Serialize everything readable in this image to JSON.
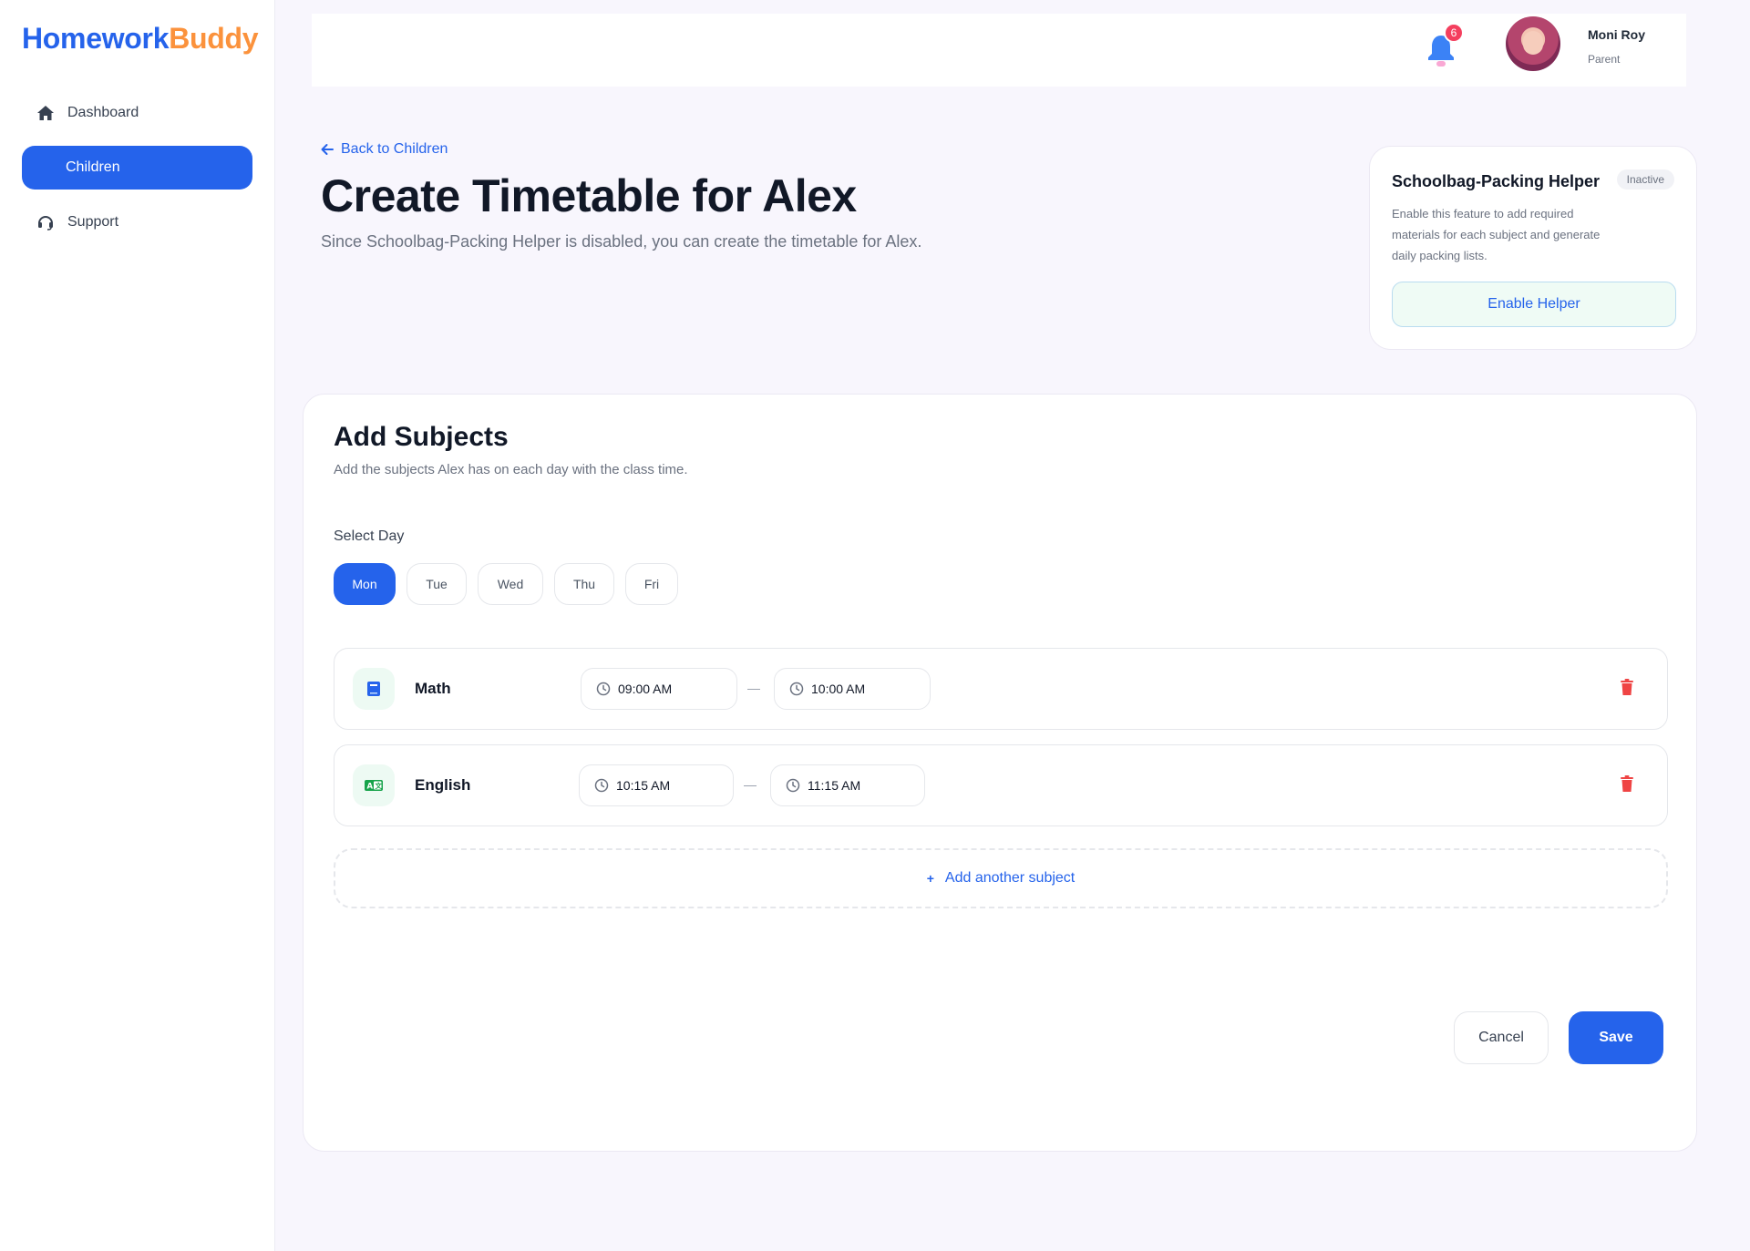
{
  "app": {
    "logo_part1": "Homework",
    "logo_part2": "Buddy",
    "brand_blue": "#2563eb",
    "brand_orange": "#fb923c"
  },
  "sidebar": {
    "items": [
      {
        "label": "Dashboard",
        "icon": "home-icon",
        "active": false
      },
      {
        "label": "Children",
        "icon": "",
        "active": true
      },
      {
        "label": "Support",
        "icon": "headset-icon",
        "active": false
      }
    ]
  },
  "header": {
    "notification_count": "6",
    "user_name": "Moni Roy",
    "user_role": "Parent"
  },
  "page": {
    "back_label": "Back to Children",
    "title": "Create Timetable for Alex",
    "subtitle": "Since Schoolbag-Packing Helper is disabled, you can create the timetable for Alex."
  },
  "helper": {
    "title": "Schoolbag-Packing Helper",
    "status": "Inactive",
    "description": "Enable this feature to add required materials for each subject and generate daily packing lists.",
    "button_label": "Enable Helper"
  },
  "subjects_card": {
    "title": "Add Subjects",
    "description": "Add the subjects Alex has on each day with the class time.",
    "day_label": "Select Day",
    "days": [
      "Mon",
      "Tue",
      "Wed",
      "Thu",
      "Fri"
    ],
    "selected_day": "Mon",
    "subjects": [
      {
        "name": "Math",
        "icon": "book-icon",
        "start": "09:00 AM",
        "end": "10:00 AM"
      },
      {
        "name": "English",
        "icon": "translate-icon",
        "start": "10:15 AM",
        "end": "11:15 AM"
      }
    ],
    "add_label": "Add another subject",
    "cancel_label": "Cancel",
    "save_label": "Save"
  }
}
